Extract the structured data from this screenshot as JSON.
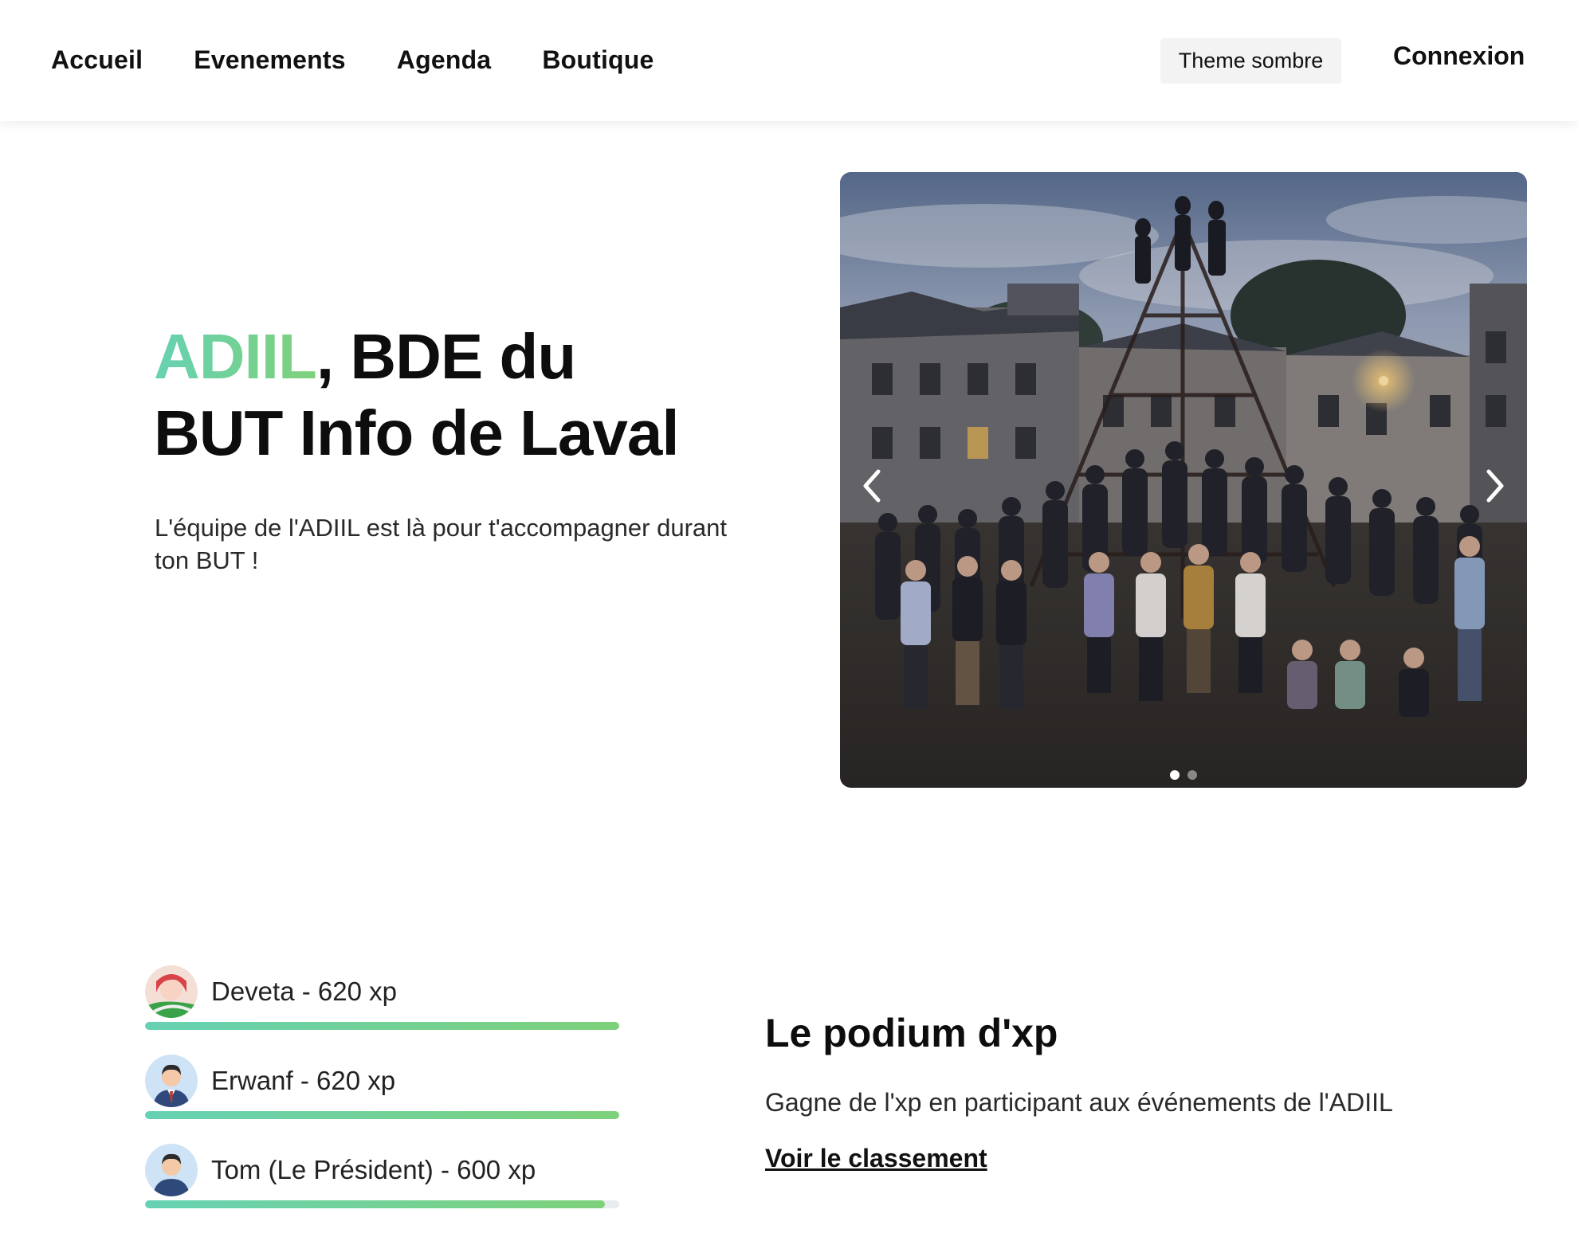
{
  "nav": {
    "links": [
      "Accueil",
      "Evenements",
      "Agenda",
      "Boutique"
    ],
    "theme_button": "Theme sombre",
    "login": "Connexion"
  },
  "hero": {
    "title_accent": "ADIIL",
    "title_rest_line1": ", BDE du",
    "title_line2": "BUT Info de Laval",
    "subtitle": "L'équipe de l'ADIIL est là pour t'accompagner durant ton BUT !"
  },
  "carousel": {
    "slides": 2,
    "active_slide": 1,
    "prev_icon": "chevron-left-icon",
    "next_icon": "chevron-right-icon"
  },
  "leaderboard": [
    {
      "text": "Deveta - 620 xp",
      "progress": 1.0
    },
    {
      "text": "Erwanf - 620 xp",
      "progress": 1.0
    },
    {
      "text": "Tom (Le Président) - 600 xp",
      "progress": 0.97
    }
  ],
  "podium": {
    "title": "Le podium d'xp",
    "description": "Gagne de l'xp en participant aux événements de l'ADIIL",
    "link": "Voir le classement"
  },
  "colors": {
    "accent_start": "#66d1b3",
    "accent_end": "#7ed17a",
    "theme_button_bg": "#f3f3f3"
  }
}
